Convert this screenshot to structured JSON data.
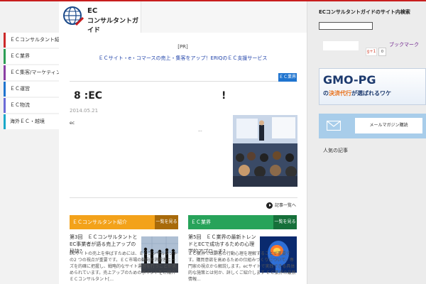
{
  "colors": {
    "accent": "#c81e1e",
    "link": "#2244aa",
    "badge": "#1f74cf",
    "section1": "#f3a21a",
    "section1_more": "#a86a0a",
    "section2": "#27a35a",
    "section2_more": "#16703a"
  },
  "logo": {
    "line1": "EC",
    "line2": "コンサルタントガイド",
    "icon": "globe-pen-icon"
  },
  "nav": [
    {
      "label": "ＥＣコンサルタント紹介",
      "color": "#cc2a2a"
    },
    {
      "label": "ＥＣ業界",
      "color": "#2e9e55"
    },
    {
      "label": "ＥＣ集客/マーケティング",
      "color": "#8a3fa3"
    },
    {
      "label": "ＥＣ運営",
      "color": "#1f74cf"
    },
    {
      "label": "ＥＣ物流",
      "color": "#6b6bd6"
    },
    {
      "label": "海外ＥＣ・越境",
      "color": "#1aa8c9"
    }
  ],
  "pr": {
    "label": "[PR]",
    "link": "ＥＣサイト・e・コマースの売上・集客をアップ！ERIQのＥＣ支援サービス"
  },
  "article": {
    "category": "ＥＣ業界",
    "title": "8 :EC　　　　　　　　　　　　!",
    "date": "2014.05.21",
    "excerpt": "ec",
    "ellipsis": "..."
  },
  "list_link": "記事一覧へ",
  "sections": [
    {
      "title": "ＥＣコンサルタント紹介",
      "more": "一覧を見る",
      "card_title": "第3回　ＥＣコンサルタントとEC事業者が語る売上アップの秘訣?",
      "card_body": "ECサイトの売上を伸ばすためには、ＥＣコンサルタントの2 つの視点が重要です。ＥＣ市場の動向や消費者ニーズを的確に把握し、戦略的なサイト運営を行うことが求められています。売上アップのためのポイントをご紹介 ＥＣコンサルタント[...",
      "img": "people-silhouette-image"
    },
    {
      "title": "ＥＣ業界",
      "more": "一覧を見る",
      "card_title": "第5回　ＥＣ業界の最新トレンドとECで成功するための心理学的アプローチ?",
      "card_body": "ＥＣ業界では顧客の行動心理を理解することが重要です。購買意欲を高めるための仕組みづくりについて、専門家の視点から解説します。ecサイトで実践できる具体的な施策とは何か、詳しくご紹介します ＥＣ業界の最新情報...",
      "img": "brain-image"
    }
  ],
  "sidebar": {
    "title": "ECコンサルタントガイドのサイト内検索",
    "search_value": "",
    "share_label": "ブックマーク",
    "gplus": "g+1",
    "gplus_count": "0",
    "banner_main": "GMO-PG",
    "banner_sub_pre": "の",
    "banner_sub_hl": "決済代行",
    "banner_sub_mid": "が",
    "banner_sub_post": "選ばれるワケ",
    "mail_label": "メールマガジン購読",
    "bottom_label": "人気の記事"
  }
}
